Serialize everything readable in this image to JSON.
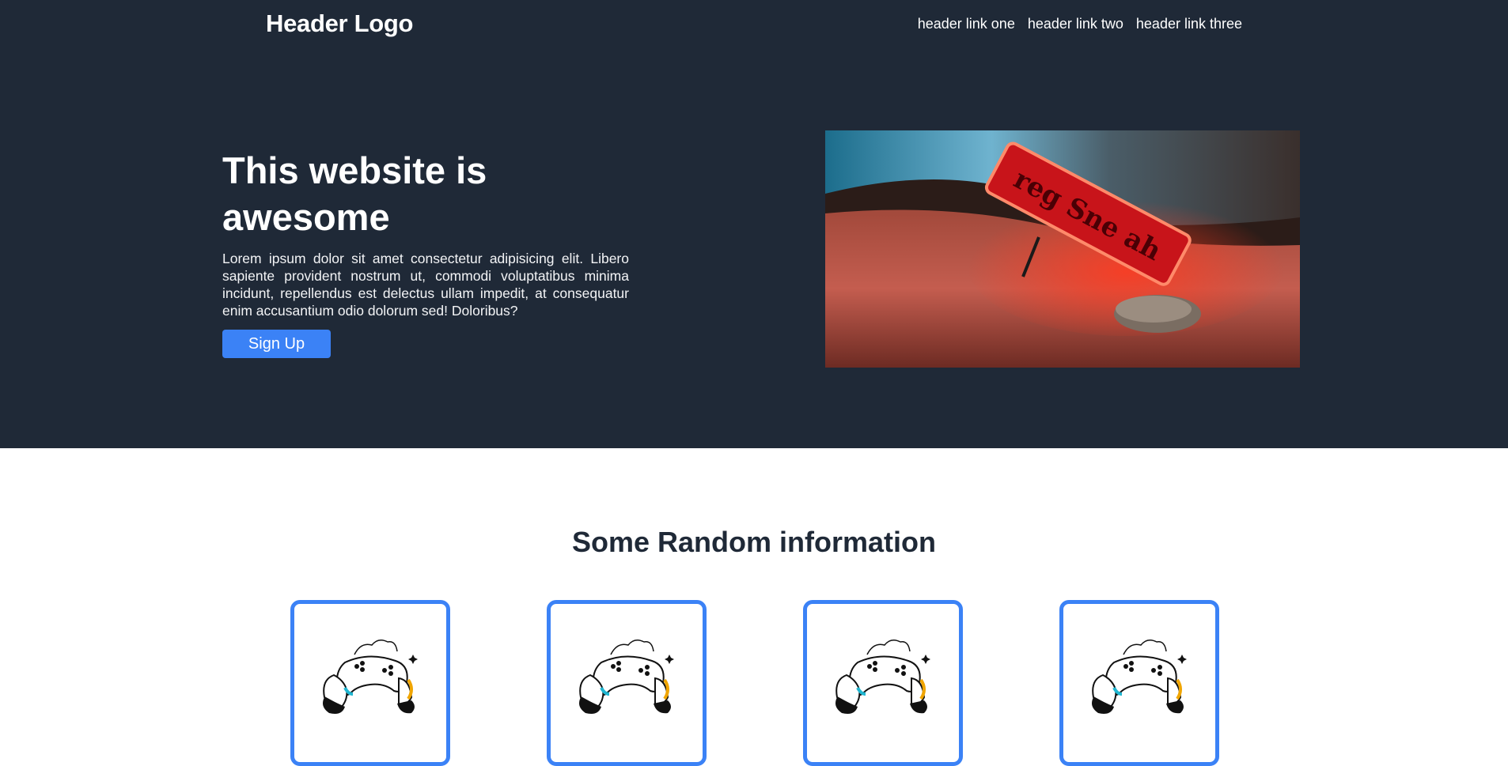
{
  "header": {
    "logo": "Header Logo",
    "links": [
      "header link one",
      "header link two",
      "header link three"
    ]
  },
  "hero": {
    "title": "This website is awesome",
    "body": "Lorem ipsum dolor sit amet consectetur adipisicing elit. Libero sapiente provident nostrum ut, commodi voluptatibus minima incidunt, repellendus est delectus ullam impedit, at consequatur enim accusantium odio dolorum sed! Doloribus?",
    "button": "Sign Up",
    "image_icon": "neon-sign-desert-photo"
  },
  "info": {
    "title": "Some Random information",
    "cards": [
      {
        "icon": "gamepad-hands-icon"
      },
      {
        "icon": "gamepad-hands-icon"
      },
      {
        "icon": "gamepad-hands-icon"
      },
      {
        "icon": "gamepad-hands-icon"
      }
    ]
  },
  "colors": {
    "hero_bg": "#1f2937",
    "accent": "#3b82f6",
    "heading": "#1f2937"
  }
}
